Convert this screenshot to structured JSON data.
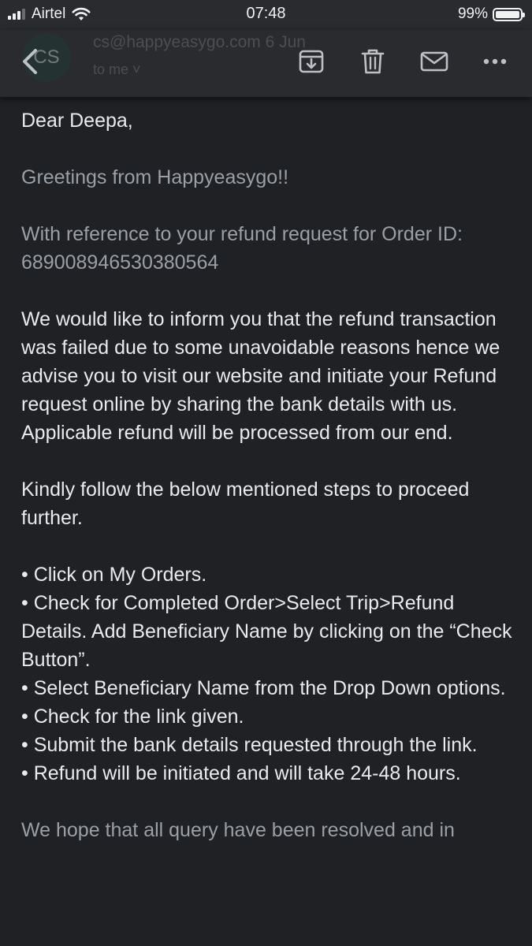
{
  "status_bar": {
    "carrier": "Airtel",
    "time": "07:48",
    "battery_percent": "99%",
    "battery_level": 0.99,
    "signal_bars": 3,
    "signal_bars_total": 4
  },
  "header": {
    "avatar_initials": "CS",
    "sender": "cs@happyeasygo.com  6 Jun",
    "recipient": "to me ˅",
    "icons": [
      "back-icon",
      "archive-icon",
      "delete-icon",
      "mark-unread-icon",
      "more-icon"
    ]
  },
  "email": {
    "greeting": "Dear Deepa,",
    "line_greetings": "Greetings from Happyeasygo!!",
    "line_reference": "With reference to your refund request for Order ID: 689008946530380564",
    "paragraph_failed": "We would like to inform you that the refund transaction was failed due to some unavoidable reasons hence we advise you to visit our website and initiate your Refund request online by sharing the bank details with us. Applicable refund will be processed from our end.",
    "paragraph_steps_intro": "Kindly follow the below mentioned steps to proceed further.",
    "steps": [
      "Click on My Orders.",
      "Check for Completed Order>Select Trip>Refund Details. Add Beneficiary Name by clicking on the “Check Button”.",
      "Select Beneficiary Name from the Drop Down options.",
      "Check for the link given.",
      "Submit the bank details requested through the link.",
      "Refund will be initiated and will take 24-48 hours."
    ],
    "closing": "We hope that all query have been resolved and in"
  },
  "colors": {
    "background": "#202124",
    "app_bar": "#2a2b2e",
    "text": "#e8eaed",
    "text_dim": "#9aa0a6",
    "icon": "#bdc1c6"
  }
}
